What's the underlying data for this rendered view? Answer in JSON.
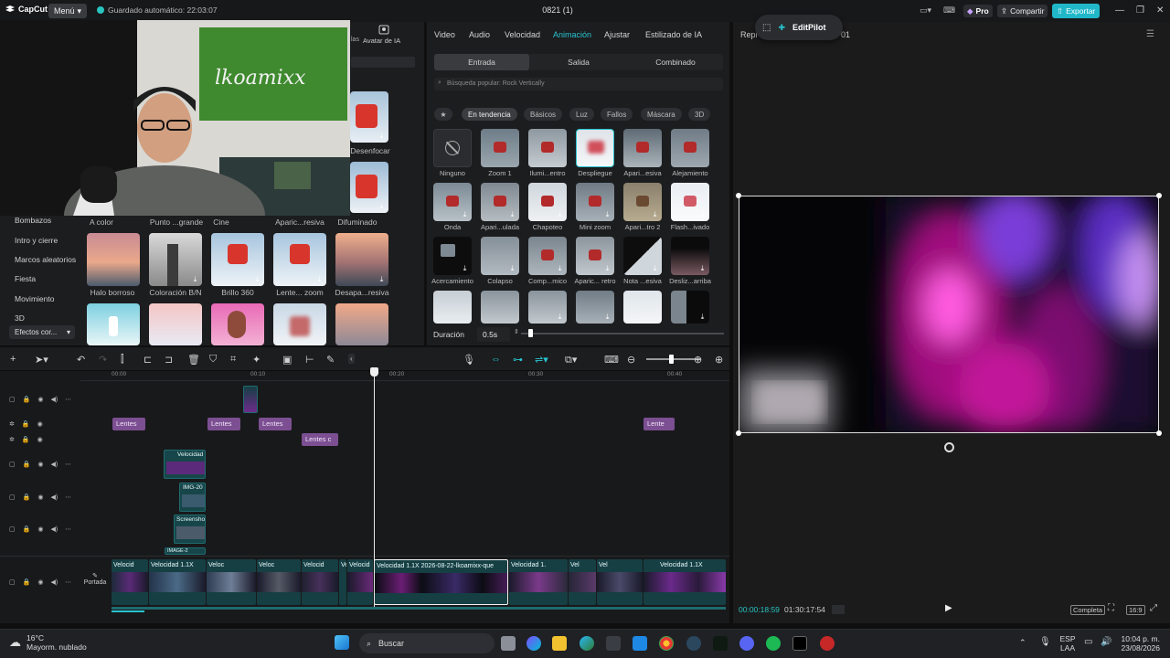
{
  "app": {
    "logo": "CapCut",
    "menu": "Menú",
    "autosave": "Guardado automático: 22:03:07",
    "project_title": "0821 (1)",
    "pro": "Pro",
    "share": "Compartir",
    "export": "Exportar"
  },
  "left_panel": {
    "ai_avatar_tab": "Avatar de IA",
    "tab_fragment": "las",
    "categories": [
      "Bombazos",
      "Intro y cierre",
      "Marcos aleatorios",
      "Fiesta",
      "Movimiento",
      "3D"
    ],
    "category_select": "Efectos cor...",
    "row0_labels": [
      "A color",
      "Punto ...grande",
      "Cine",
      "Aparic...resiva",
      "Difuminado"
    ],
    "side_label": "Desenfocar",
    "row1_labels": [
      "Halo borroso",
      "Coloración B/N",
      "Brillo 360",
      "Lente... zoom",
      "Desapa...resiva"
    ]
  },
  "anim_panel": {
    "tabs": [
      "Video",
      "Audio",
      "Velocidad",
      "Animación",
      "Ajustar",
      "Estilizado de IA"
    ],
    "active_tab": "Animación",
    "segments": [
      "Entrada",
      "Salida",
      "Combinado"
    ],
    "search_placeholder": "Búsqueda popular: Rock Vertically",
    "chips": [
      "En tendencia",
      "Básicos",
      "Luz",
      "Fallos",
      "Máscara",
      "3D"
    ],
    "row1": [
      "Ninguno",
      "Zoom 1",
      "Ilumi...entro",
      "Despliegue",
      "Apari...esiva",
      "Alejamiento"
    ],
    "row2": [
      "Onda",
      "Apari...ulada",
      "Chapoteo",
      "Mini zoom",
      "Apari...tro 2",
      "Flash...ivado"
    ],
    "row3": [
      "Acercamiento",
      "Colapso",
      "Comp...mico",
      "Aparic... retro",
      "Nota ...esiva",
      "Desliz...arriba"
    ],
    "duration_label": "Duración",
    "duration_value": "0.5s"
  },
  "player": {
    "title_fragment": "Repr",
    "title_suffix": "01",
    "editpilot": "EditPilot",
    "current_time": "00:00:18:59",
    "total_time": "01:30:17:54",
    "full": "Completa",
    "ratio": "16:9"
  },
  "timeline": {
    "ruler": [
      "00:00",
      "00:10",
      "00:20",
      "00:30",
      "00:40"
    ],
    "stickers": [
      "Lentes",
      "Lentes",
      "Lentes",
      "Lentes c",
      "Lente"
    ],
    "sub_clips": [
      "Velocidad",
      "IMG-20",
      "Screensho",
      "IMAGE-2"
    ],
    "main_track_label": "Portada",
    "main_clips": [
      "Velocid",
      "Velocidad 1.1X",
      "Veloc",
      "Veloc",
      "Velocid",
      "Ve",
      "Velocid",
      "Velocidad 1.1X   2026-08-22-lkoamixx-que",
      "Velocidad 1.",
      "Vel",
      "Vel",
      "Velocidad 1.1X"
    ]
  },
  "taskbar": {
    "temperature": "16°C",
    "weather": "Mayorm. nublado",
    "search": "Buscar",
    "lang1": "ESP",
    "lang2": "LAA",
    "time": "10:04 p. m.",
    "date": "23/08/2026"
  },
  "colors": {
    "accent": "#27c4d0",
    "sticker": "#7c4f92",
    "clip": "#163f44"
  }
}
